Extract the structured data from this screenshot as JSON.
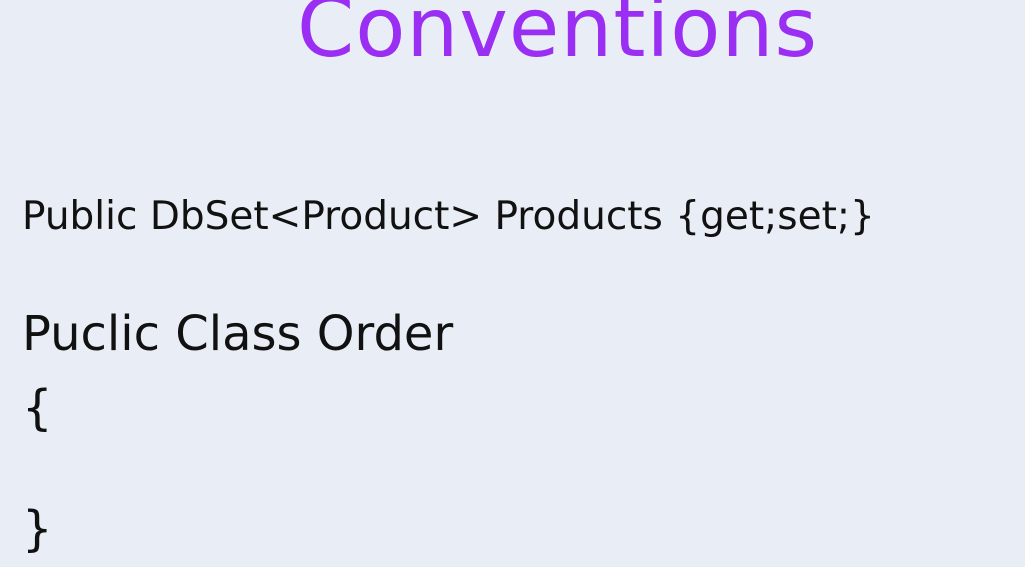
{
  "slide": {
    "title": "Conventions",
    "title_color": "#9a2ef2",
    "background_color": "#e9eef6",
    "text_color": "#111111",
    "lines": [
      "Public DbSet<Product> Products {get;set;}",
      "Puclic Class Order",
      "{",
      "}"
    ]
  }
}
